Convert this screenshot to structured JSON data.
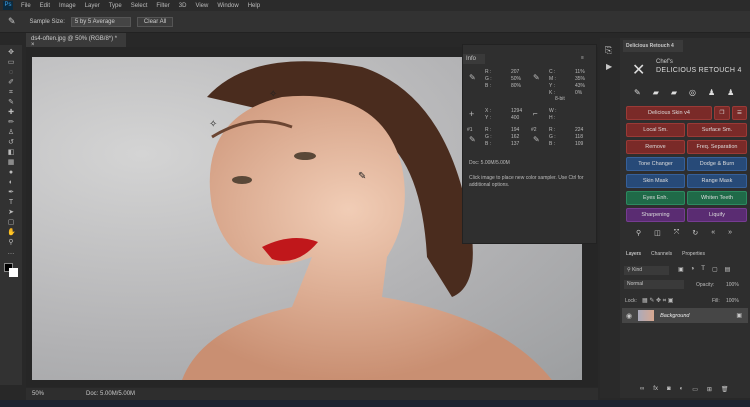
{
  "menu": {
    "logo": "Ps",
    "items": [
      "File",
      "Edit",
      "Image",
      "Layer",
      "Type",
      "Select",
      "Filter",
      "3D",
      "View",
      "Window",
      "Help"
    ]
  },
  "options": {
    "sample_size_label": "Sample Size:",
    "sample_size_value": "5 by 5 Average",
    "clear_all": "Clear All"
  },
  "document": {
    "tab": "ds4-often.jpg @ 50% (RGB/8*) *",
    "close": "×",
    "zoom": "50%",
    "doc_size": "Doc: 5.00M/5.00M"
  },
  "info": {
    "title": "Info",
    "rgb": {
      "labels": [
        "R :",
        "G :",
        "B :"
      ],
      "values": [
        "207",
        "50%",
        "80%"
      ]
    },
    "cmyk": {
      "labels": [
        "C :",
        "M :",
        "Y :",
        "K :"
      ],
      "values": [
        "11%",
        "35%",
        "43%",
        "0%"
      ],
      "bit": "8-bit"
    },
    "xy": {
      "labels": [
        "X :",
        "Y :"
      ],
      "values": [
        "1294",
        "400"
      ]
    },
    "wh": {
      "labels": [
        "W :",
        "H :"
      ]
    },
    "s1": {
      "id": "#1",
      "labels": [
        "R :",
        "G :",
        "B :"
      ],
      "values": [
        "194",
        "162",
        "137"
      ]
    },
    "s2": {
      "id": "#2",
      "labels": [
        "R :",
        "G :",
        "B :"
      ],
      "values": [
        "224",
        "118",
        "109"
      ]
    },
    "doc": "Doc: 5.00M/5.00M",
    "hint": "Click image to place new color sampler.  Use Ctrl for additional options."
  },
  "plugin": {
    "tab": "Delicious Retouch 4",
    "brand_small": "Chef's",
    "brand": "DELICIOUS RETOUCH 4",
    "buttons": {
      "skin": "Delicious Skin v4",
      "local": "Local Sm.",
      "surface": "Surface Sm.",
      "remove": "Remove",
      "freq": "Freq. Separation",
      "tone": "Tone Changer",
      "dodge": "Dodge & Burn",
      "skinmask": "Skin Mask",
      "range": "Range Mask",
      "eyes": "Eyes Enh.",
      "teeth": "Whiten Teeth",
      "sharpen": "Sharpening",
      "liquify": "Liquify"
    }
  },
  "layers": {
    "tabs": [
      "Layers",
      "Channels",
      "Properties"
    ],
    "kind": "Kind",
    "blend": "Normal",
    "opacity_label": "Opacity:",
    "opacity": "100%",
    "lock_label": "Lock:",
    "fill_label": "Fill:",
    "fill": "100%",
    "layer_name": "Background"
  }
}
